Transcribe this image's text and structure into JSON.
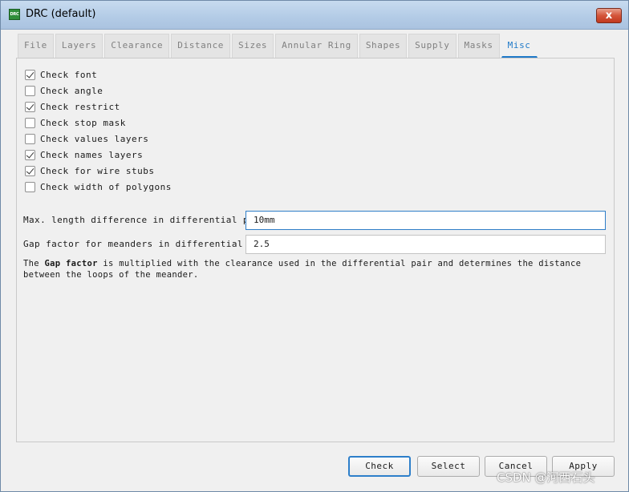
{
  "window": {
    "title": "DRC (default)",
    "icon": "drc-app-icon",
    "icon_text": "DRC",
    "close_label": "x"
  },
  "tabs": [
    {
      "label": "File",
      "active": false
    },
    {
      "label": "Layers",
      "active": false
    },
    {
      "label": "Clearance",
      "active": false
    },
    {
      "label": "Distance",
      "active": false
    },
    {
      "label": "Sizes",
      "active": false
    },
    {
      "label": "Annular Ring",
      "active": false
    },
    {
      "label": "Shapes",
      "active": false
    },
    {
      "label": "Supply",
      "active": false
    },
    {
      "label": "Masks",
      "active": false
    },
    {
      "label": "Misc",
      "active": true
    }
  ],
  "checks": [
    {
      "label": "Check font",
      "checked": true
    },
    {
      "label": "Check angle",
      "checked": false
    },
    {
      "label": "Check restrict",
      "checked": true
    },
    {
      "label": "Check stop mask",
      "checked": false
    },
    {
      "label": "Check values layers",
      "checked": false
    },
    {
      "label": "Check names layers",
      "checked": true
    },
    {
      "label": "Check for wire stubs",
      "checked": true
    },
    {
      "label": "Check width of polygons",
      "checked": false
    }
  ],
  "fields": {
    "max_length": {
      "label": "Max. length difference in differential pairs",
      "value": "10mm"
    },
    "gap_factor": {
      "label": "Gap factor for meanders in differential pairs",
      "value": "2.5"
    }
  },
  "note": {
    "prefix": "The ",
    "bold": "Gap factor",
    "suffix": " is multiplied with the clearance used in the differential pair and determines the distance between the loops of the meander."
  },
  "buttons": {
    "check": "Check",
    "select": "Select",
    "cancel": "Cancel",
    "apply": "Apply"
  },
  "watermark": "CSDN @河西石头",
  "colors": {
    "accent": "#1e79c8",
    "close": "#c1391f"
  }
}
